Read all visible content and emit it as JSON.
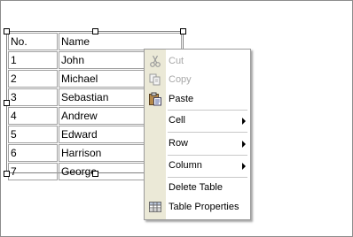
{
  "table": {
    "headers": [
      "No.",
      "Name"
    ],
    "rows": [
      [
        "1",
        "John"
      ],
      [
        "2",
        "Michael"
      ],
      [
        "3",
        "Sebastian"
      ],
      [
        "4",
        "Andrew"
      ],
      [
        "5",
        "Edward"
      ],
      [
        "6",
        "Harrison"
      ],
      [
        "7",
        "George"
      ]
    ]
  },
  "context_menu": {
    "cut": "Cut",
    "copy": "Copy",
    "paste": "Paste",
    "cell": "Cell",
    "row": "Row",
    "column": "Column",
    "delete_table": "Delete Table",
    "table_properties": "Table Properties"
  },
  "icons": {
    "cut": "scissors-icon",
    "copy": "copy-icon",
    "paste": "clipboard-icon",
    "table_properties": "table-icon",
    "submenu": "chevron-right-icon"
  },
  "colors": {
    "gutter": "#ebe9d7",
    "disabled_text": "#a8a8a8"
  }
}
